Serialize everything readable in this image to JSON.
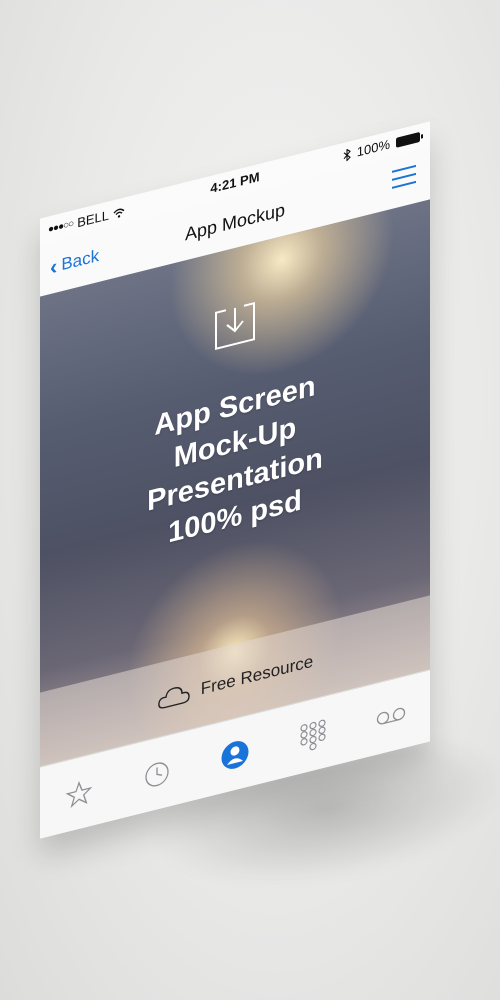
{
  "status_bar": {
    "signal_dots": "●●●○○",
    "carrier": "BELL",
    "time": "4:21 PM",
    "battery_percent": "100%"
  },
  "nav_bar": {
    "back_label": "Back",
    "title": "App Mockup"
  },
  "hero": {
    "headline_lines": [
      "App Screen",
      "Mock-Up",
      "Presentation",
      "100% psd"
    ],
    "footer_label": "Free Resource"
  },
  "tab_bar": {
    "items": [
      {
        "icon": "star-icon"
      },
      {
        "icon": "clock-icon"
      },
      {
        "icon": "contact-icon",
        "active": true
      },
      {
        "icon": "keypad-icon"
      },
      {
        "icon": "voicemail-icon"
      }
    ]
  },
  "colors": {
    "accent": "#1a73d9",
    "icon_gray": "#8e8e93"
  }
}
